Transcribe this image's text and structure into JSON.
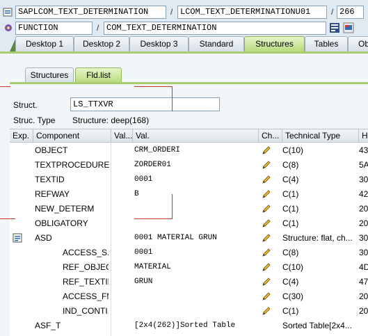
{
  "header": {
    "row1": {
      "program": "SAPLCOM_TEXT_DETERMINATION",
      "sep1": "/",
      "include": "LCOM_TEXT_DETERMINATIONU01",
      "sep2": "/",
      "line": "266"
    },
    "row2": {
      "type": "FUNCTION",
      "sep": "/",
      "name": "COM_TEXT_DETERMINATION"
    }
  },
  "tabs": [
    "Desktop 1",
    "Desktop 2",
    "Desktop 3",
    "Standard",
    "Structures",
    "Tables",
    "Ob"
  ],
  "inner_tabs": [
    "Structures",
    "Fld.list"
  ],
  "struct": {
    "label": "Struct.",
    "value": "LS_TTXVR",
    "type_label": "Struc. Type",
    "type_value": "Structure: deep(168)"
  },
  "table": {
    "headers": [
      "Exp.",
      "Component",
      "Val...",
      "Val.",
      "Ch...",
      "Technical Type",
      "He"
    ],
    "rows": [
      {
        "component": "OBJECT",
        "val": "CRM_ORDERI",
        "type": "C(10)",
        "hex": "43"
      },
      {
        "component": "TEXTPROCEDURE",
        "val": "ZORDER01",
        "type": "C(8)",
        "hex": "5A"
      },
      {
        "component": "TEXTID",
        "val": "0001",
        "type": "C(4)",
        "hex": "30"
      },
      {
        "component": "REFWAY",
        "val": "B",
        "type": "C(1)",
        "hex": "42"
      },
      {
        "component": "NEW_DETERM",
        "val": "",
        "type": "C(1)",
        "hex": "20"
      },
      {
        "component": "OBLIGATORY",
        "val": "",
        "type": "C(1)",
        "hex": "20"
      },
      {
        "component": "ASD",
        "val": "0001     MATERIAL  GRUN",
        "type": "Structure: flat, ch...",
        "hex": "30"
      },
      {
        "component": "ACCESS_S...",
        "val": "0001",
        "type": "C(8)",
        "hex": "30"
      },
      {
        "component": "REF_OBJEC...",
        "val": "MATERIAL",
        "type": "C(10)",
        "hex": "4D"
      },
      {
        "component": "REF_TEXTID",
        "val": "GRUN",
        "type": "C(4)",
        "hex": "47"
      },
      {
        "component": "ACCESS_FM",
        "val": "",
        "type": "C(30)",
        "hex": "20"
      },
      {
        "component": "IND_CONTI...",
        "val": "",
        "type": "C(1)",
        "hex": "20"
      },
      {
        "component": "ASF_T",
        "val": "[2x4(262)]Sorted Table",
        "type": "Sorted Table[2x4...",
        "hex": ""
      }
    ]
  },
  "colors": {
    "tab_active": "#b7da7c",
    "panel_bg": "#f3f6f8",
    "app_bg": "#dfeaf2",
    "accent_line": "#a9cd6e",
    "annotation_red": "#c0392b"
  },
  "icons": [
    "program-icon",
    "function-icon",
    "pattern-icon",
    "flag-icon",
    "expand-structure-icon",
    "pencil-icon"
  ]
}
